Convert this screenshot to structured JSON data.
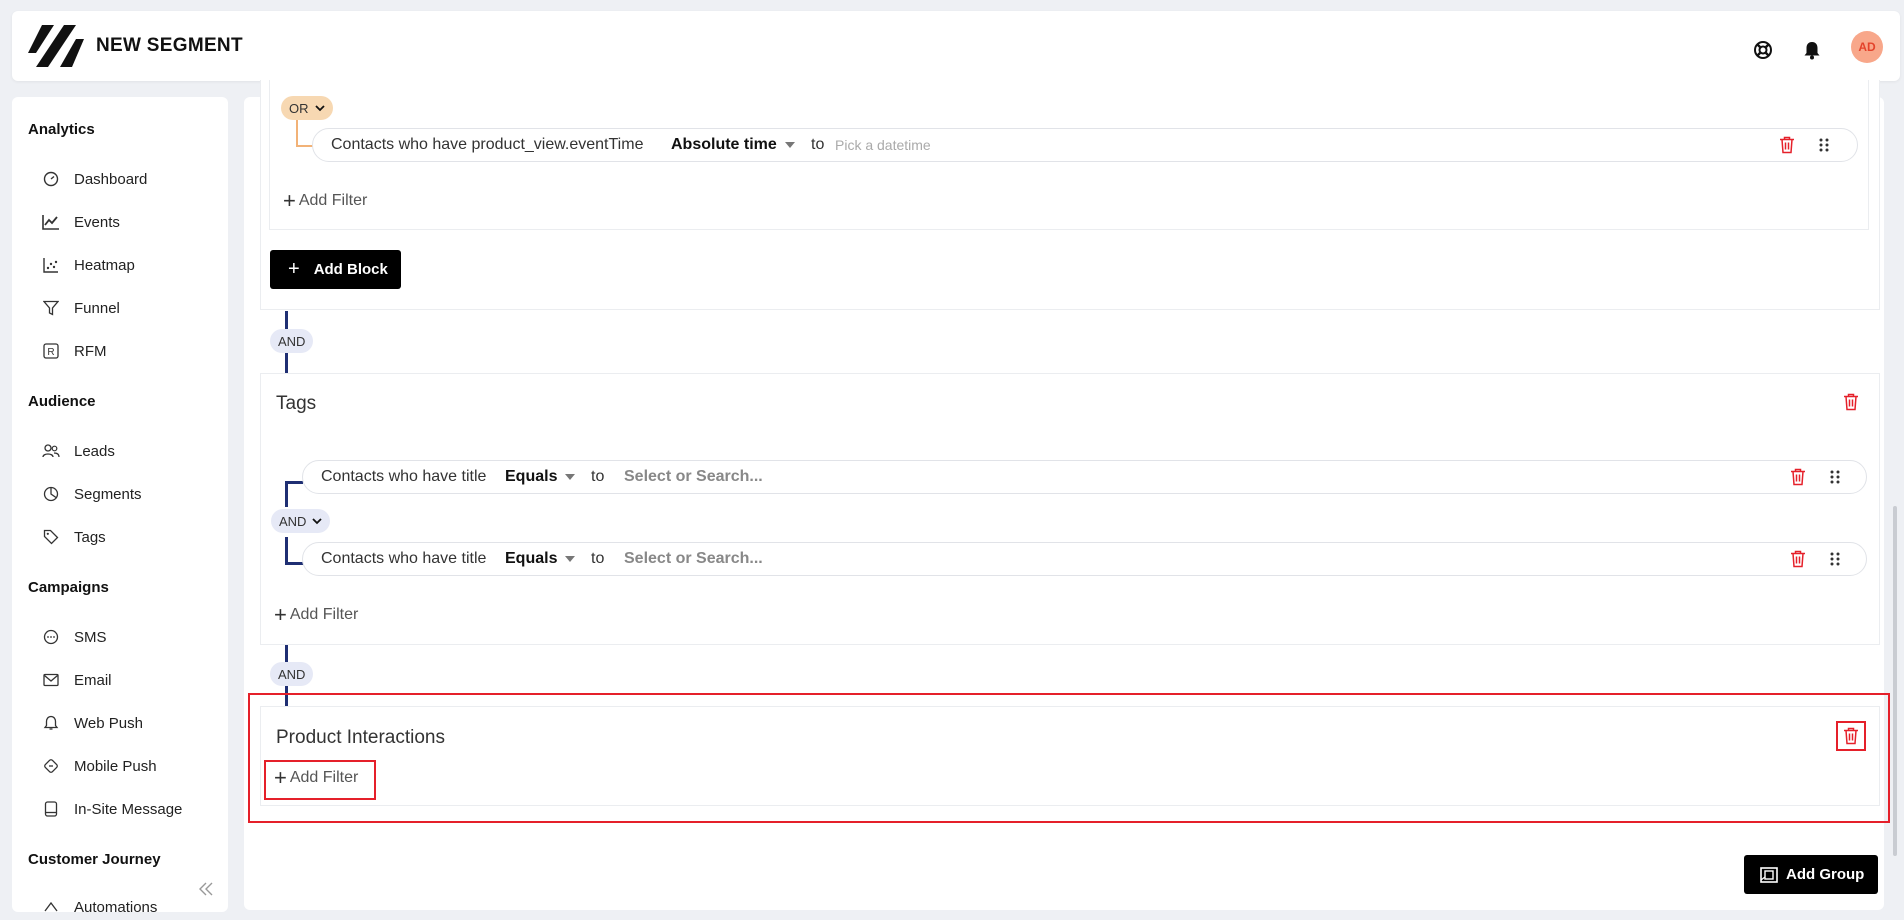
{
  "header": {
    "title": "NEW SEGMENT",
    "avatar_initials": "AD",
    "icons": [
      "support-icon",
      "bell-icon"
    ]
  },
  "sidebar": {
    "sections": [
      {
        "label": "Analytics"
      },
      {
        "label": "Audience"
      },
      {
        "label": "Campaigns"
      },
      {
        "label": "Customer Journey"
      }
    ],
    "items": [
      {
        "label": "Dashboard",
        "icon": "dashboard-icon"
      },
      {
        "label": "Events",
        "icon": "events-icon"
      },
      {
        "label": "Heatmap",
        "icon": "heatmap-icon"
      },
      {
        "label": "Funnel",
        "icon": "funnel-icon"
      },
      {
        "label": "RFM",
        "icon": "rfm-icon"
      },
      {
        "label": "Leads",
        "icon": "leads-icon"
      },
      {
        "label": "Segments",
        "icon": "segments-icon"
      },
      {
        "label": "Tags",
        "icon": "tags-icon"
      },
      {
        "label": "SMS",
        "icon": "sms-icon"
      },
      {
        "label": "Email",
        "icon": "email-icon"
      },
      {
        "label": "Web Push",
        "icon": "web-push-icon"
      },
      {
        "label": "Mobile Push",
        "icon": "mobile-push-icon"
      },
      {
        "label": "In-Site Message",
        "icon": "in-site-message-icon"
      },
      {
        "label": "Automations",
        "icon": "automations-icon"
      }
    ]
  },
  "main": {
    "block1": {
      "logic": "OR",
      "filter": {
        "text": "Contacts who have product_view.eventTime",
        "operator": "Absolute time",
        "to": "to",
        "placeholder": "Pick a datetime"
      },
      "add_filter": "Add Filter",
      "add_block": "Add Block"
    },
    "and1": "AND",
    "tags": {
      "title": "Tags",
      "logic": "AND",
      "filters": [
        {
          "text": "Contacts who have title",
          "operator": "Equals",
          "to": "to",
          "value": "Select or Search..."
        },
        {
          "text": "Contacts who have title",
          "operator": "Equals",
          "to": "to",
          "value": "Select or Search..."
        }
      ],
      "add_filter": "Add Filter"
    },
    "and2": "AND",
    "product": {
      "title": "Product Interactions",
      "add_filter": "Add Filter"
    },
    "add_group": "Add Group"
  },
  "colors": {
    "accent_dark": "#1f2f73",
    "danger": "#e5202a",
    "or_tag": "#f7d8b2",
    "and_tag": "#e6e9f6"
  }
}
